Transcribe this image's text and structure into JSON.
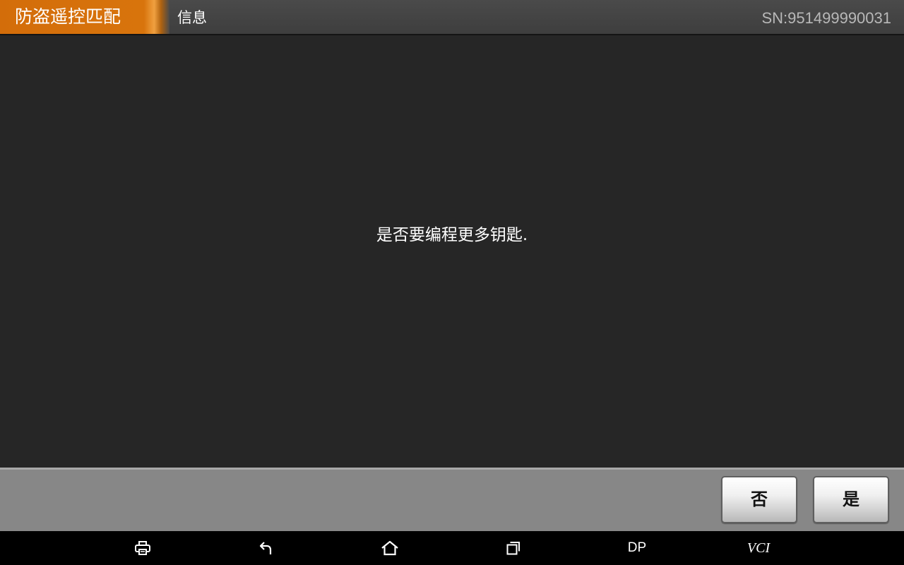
{
  "header": {
    "app_title": "防盗遥控匹配",
    "page_title": "信息",
    "serial_number": "SN:951499990031"
  },
  "dialog": {
    "message": "是否要编程更多钥匙."
  },
  "actions": {
    "no_label": "否",
    "yes_label": "是"
  },
  "nav_bar": {
    "items": [
      {
        "icon": "print-icon"
      },
      {
        "icon": "back-icon"
      },
      {
        "icon": "home-icon"
      },
      {
        "icon": "recent-apps-icon"
      },
      {
        "label": "DP"
      },
      {
        "label": "VCI"
      }
    ]
  },
  "colors": {
    "accent_orange": "#d8740c",
    "header_bg": "#444444",
    "content_bg": "#262626",
    "action_bar_bg": "#878787",
    "nav_bar_bg": "#000000"
  }
}
